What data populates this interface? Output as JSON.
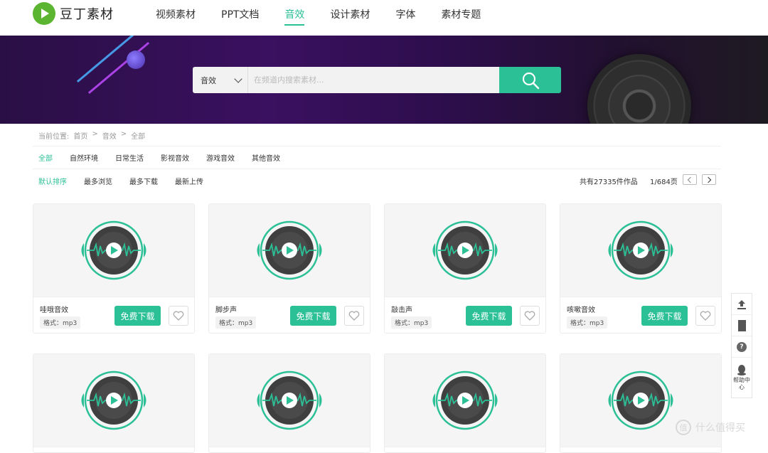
{
  "header": {
    "logo_text": "豆丁素材",
    "nav": [
      "视频素材",
      "PPT文档",
      "音效",
      "设计素材",
      "字体",
      "素材专题"
    ],
    "active_nav": 2
  },
  "search": {
    "category": "音效",
    "placeholder": "在频道内搜索素材..."
  },
  "breadcrumb": {
    "label": "当前位置:",
    "items": [
      "首页",
      ">",
      "音效",
      ">",
      "全部"
    ]
  },
  "categories": [
    "全部",
    "自然环境",
    "日常生活",
    "影视音效",
    "游戏音效",
    "其他音效"
  ],
  "sorts": [
    "默认排序",
    "最多浏览",
    "最多下载",
    "最新上传"
  ],
  "total": "共有27335件作品",
  "pagination": "1/684页",
  "download_label": "免费下载",
  "cards": [
    {
      "name": "哇哦音效",
      "format": "格式：mp3"
    },
    {
      "name": "脚步声",
      "format": "格式：mp3"
    },
    {
      "name": "敲击声",
      "format": "格式：mp3"
    },
    {
      "name": "咳嗽音效",
      "format": "格式：mp3"
    }
  ],
  "side": {
    "help_label": "帮助中心"
  },
  "watermark": "什么值得买",
  "colors": {
    "accent": "#2bc096",
    "brand_green": "#5cb531",
    "banner": "#2a0f45"
  }
}
